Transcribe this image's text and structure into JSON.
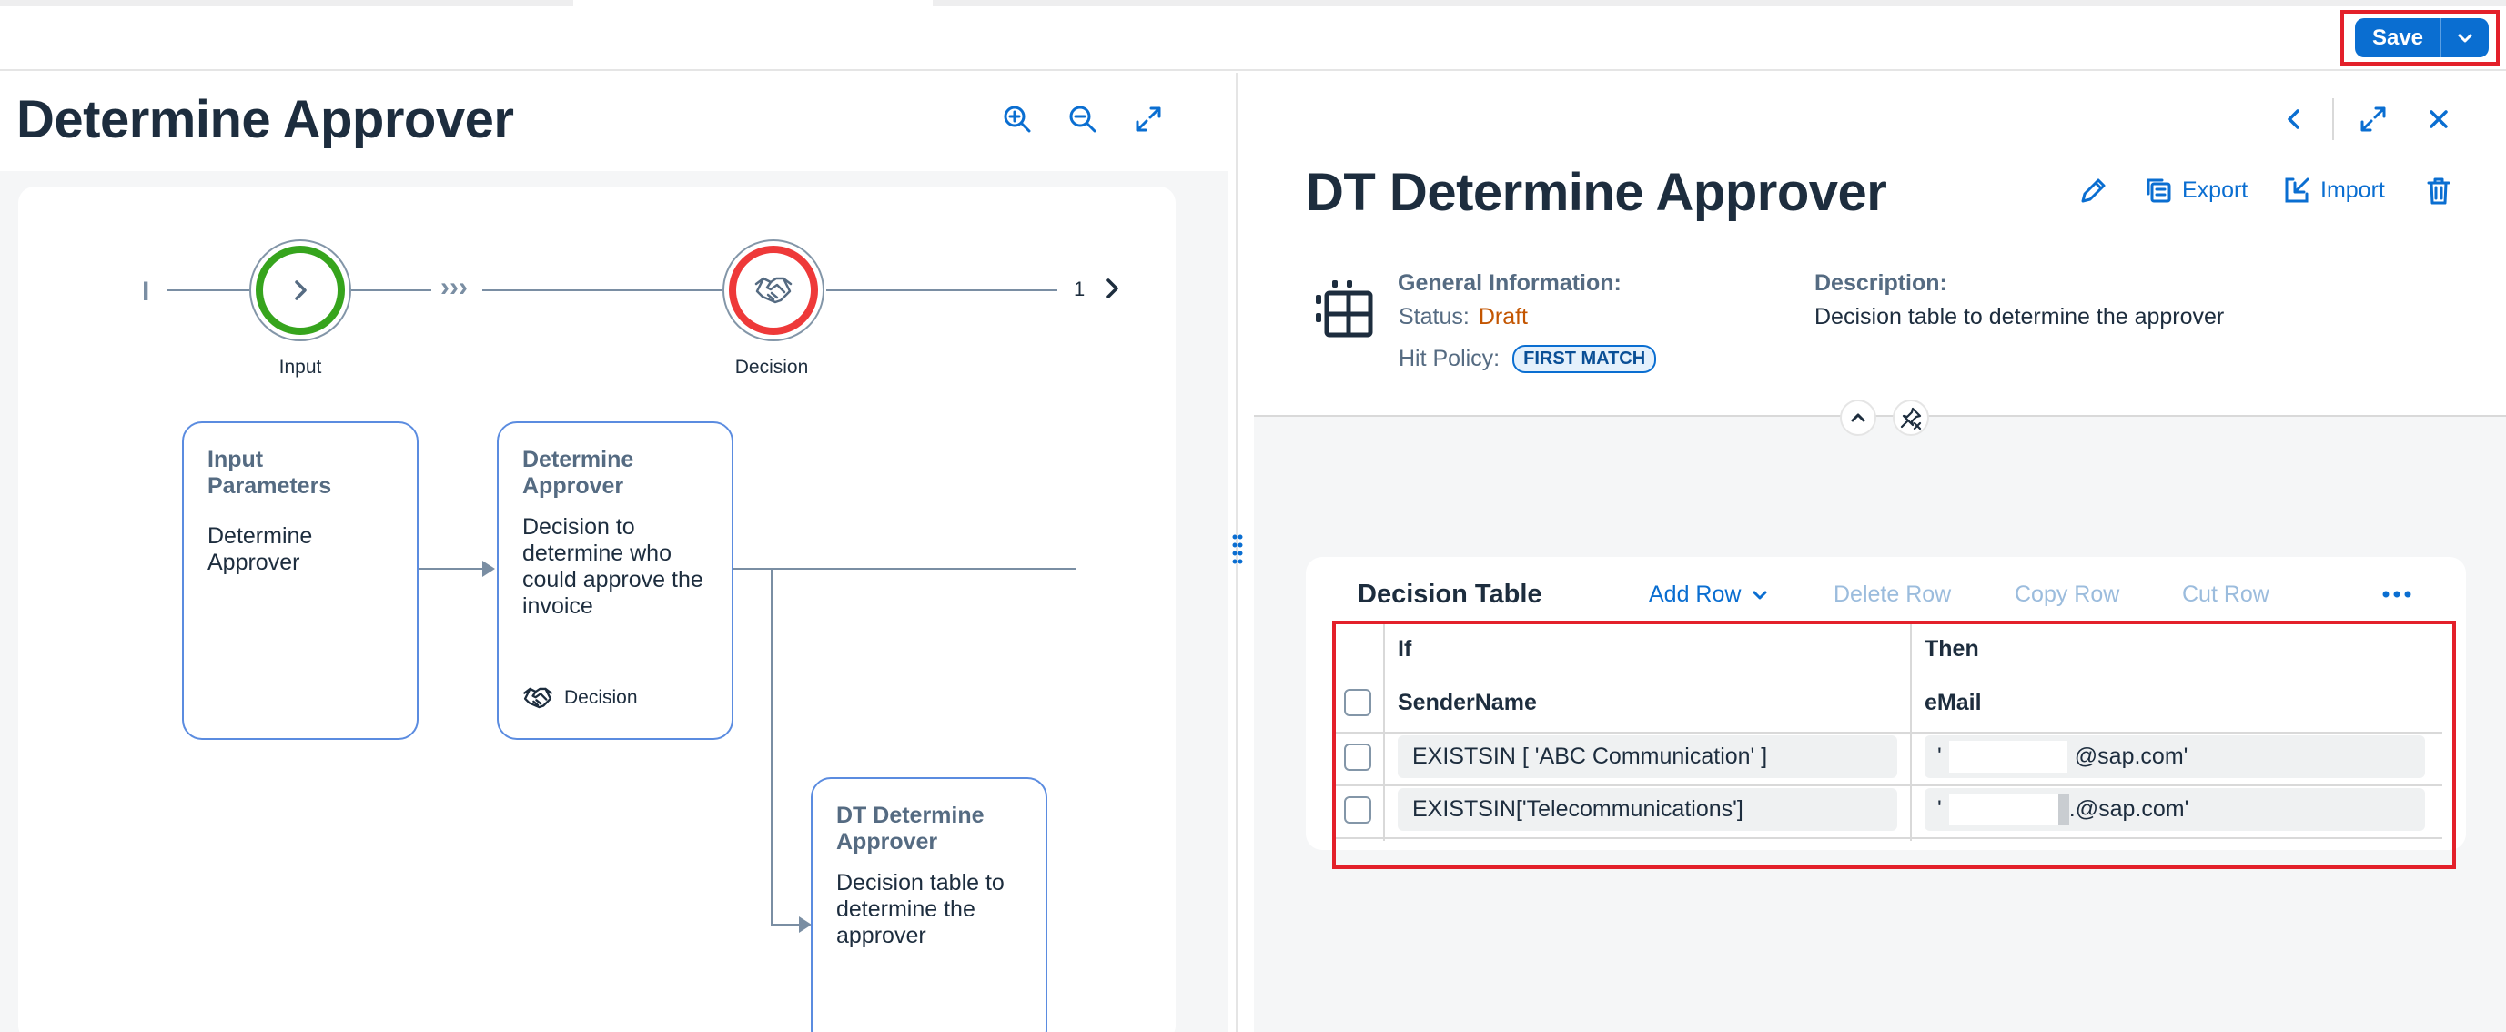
{
  "header": {
    "save_label": "Save"
  },
  "left": {
    "title": "Determine Approver",
    "flow": {
      "start_marker": "I",
      "input_label": "Input",
      "decision_label": "Decision",
      "arrows": "›››",
      "page_indicator": "1"
    },
    "cards": [
      {
        "title": "Input Parameters",
        "body": "Determine Approver"
      },
      {
        "title": "Determine Approver",
        "body": "Decision to determine who could approve the invoice",
        "footer": "Decision"
      },
      {
        "title": "DT Determine Approver",
        "body": "Decision table to determine the approver"
      }
    ]
  },
  "right": {
    "title": "DT Determine Approver",
    "actions": {
      "export": "Export",
      "import": "Import"
    },
    "general_info_label": "General Information:",
    "status_label": "Status:",
    "status_value": "Draft",
    "hit_policy_label": "Hit Policy:",
    "hit_policy_value": "FIRST MATCH",
    "description_label": "Description:",
    "description_value": "Decision table to determine the approver",
    "decision_table": {
      "label": "Decision Table",
      "toolbar": {
        "add_row": "Add Row",
        "delete_row": "Delete Row",
        "copy_row": "Copy Row",
        "cut_row": "Cut Row"
      },
      "if_label": "If",
      "then_label": "Then",
      "columns": [
        "SenderName",
        "eMail"
      ],
      "rows": [
        {
          "sender": "EXISTSIN [ 'ABC Communication' ]",
          "email_prefix": "'",
          "email_suffix": "@sap.com'"
        },
        {
          "sender": "EXISTSIN['Telecommunications']",
          "email_prefix": "'",
          "email_suffix": ".@sap.com'"
        }
      ]
    }
  },
  "colors": {
    "accent": "#0a6ed1",
    "highlight": "#e3202a",
    "draft": "#c35500",
    "input_ring": "#36a41d",
    "decision_ring": "#ee3939"
  }
}
